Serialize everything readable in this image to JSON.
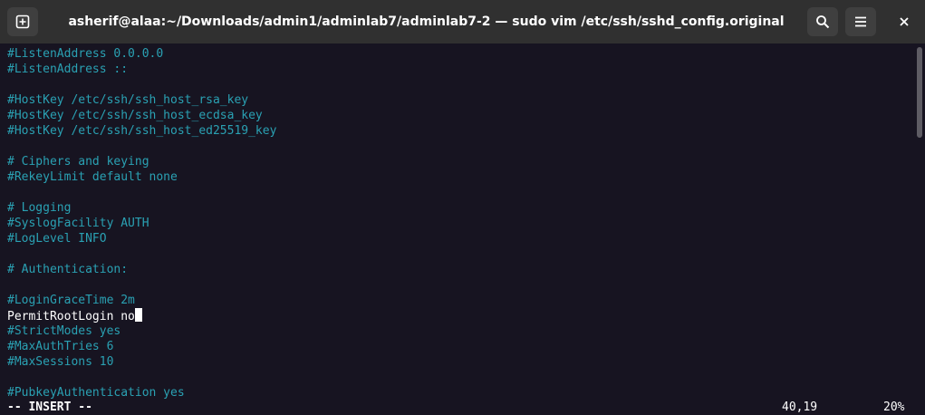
{
  "window": {
    "title": "asherif@alaa:~/Downloads/admin1/adminlab7/adminlab7-2 — sudo vim /etc/ssh/sshd_config.original"
  },
  "icons": {
    "new_tab": "new-tab-icon",
    "search": "search-icon",
    "menu": "hamburger-menu-icon",
    "close": "close-icon"
  },
  "editor": {
    "lines": [
      {
        "text": "#ListenAddress 0.0.0.0",
        "kind": "comment"
      },
      {
        "text": "#ListenAddress ::",
        "kind": "comment"
      },
      {
        "text": "",
        "kind": "comment"
      },
      {
        "text": "#HostKey /etc/ssh/ssh_host_rsa_key",
        "kind": "comment"
      },
      {
        "text": "#HostKey /etc/ssh/ssh_host_ecdsa_key",
        "kind": "comment"
      },
      {
        "text": "#HostKey /etc/ssh/ssh_host_ed25519_key",
        "kind": "comment"
      },
      {
        "text": "",
        "kind": "comment"
      },
      {
        "text": "# Ciphers and keying",
        "kind": "comment"
      },
      {
        "text": "#RekeyLimit default none",
        "kind": "comment"
      },
      {
        "text": "",
        "kind": "comment"
      },
      {
        "text": "# Logging",
        "kind": "comment"
      },
      {
        "text": "#SyslogFacility AUTH",
        "kind": "comment"
      },
      {
        "text": "#LogLevel INFO",
        "kind": "comment"
      },
      {
        "text": "",
        "kind": "comment"
      },
      {
        "text": "# Authentication:",
        "kind": "comment"
      },
      {
        "text": "",
        "kind": "comment"
      },
      {
        "text": "#LoginGraceTime 2m",
        "kind": "comment"
      },
      {
        "text": "PermitRootLogin no",
        "kind": "plain"
      },
      {
        "text": "#StrictModes yes",
        "kind": "comment"
      },
      {
        "text": "#MaxAuthTries 6",
        "kind": "comment"
      },
      {
        "text": "#MaxSessions 10",
        "kind": "comment"
      },
      {
        "text": "",
        "kind": "comment"
      },
      {
        "text": "#PubkeyAuthentication yes",
        "kind": "comment"
      }
    ],
    "cursor_line": 17
  },
  "status": {
    "mode": "-- INSERT --",
    "position": "40,19",
    "percent": "20%"
  },
  "colors": {
    "comment": "#2aa1b3",
    "plain": "#ffffff",
    "background": "#171421",
    "titlebar": "#303030"
  }
}
